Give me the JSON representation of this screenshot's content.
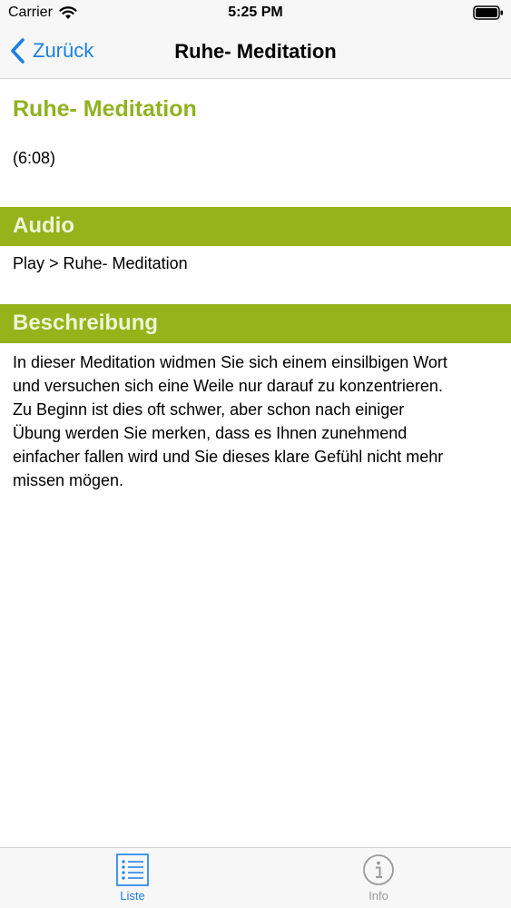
{
  "status_bar": {
    "carrier": "Carrier",
    "time": "5:25 PM"
  },
  "nav": {
    "back_label": "Zurück",
    "title": "Ruhe- Meditation"
  },
  "content": {
    "title": "Ruhe- Meditation",
    "duration": "(6:08)",
    "audio_header": "Audio",
    "audio_item": "Play > Ruhe- Meditation",
    "description_header": "Beschreibung",
    "description_lines": [
      "In dieser Meditation widmen Sie sich einem einsilbigen Wort",
      "und versuchen sich eine Weile nur darauf zu konzentrieren.",
      "Zu Beginn ist dies oft schwer, aber schon nach einiger",
      "Übung werden Sie merken, dass es Ihnen zunehmend",
      "einfacher fallen wird und Sie dieses klare Gefühl nicht mehr",
      "missen mögen."
    ]
  },
  "tab_bar": {
    "tabs": [
      {
        "label": "Liste",
        "icon": "list-icon",
        "selected": true
      },
      {
        "label": "Info",
        "icon": "info-icon",
        "selected": false
      }
    ]
  },
  "colors": {
    "accent_blue": "#1a7fe6",
    "title_green": "#8fb220",
    "section_green": "#97b21b",
    "section_text": "#eef4d6",
    "inactive_gray": "#9a9a9a"
  }
}
